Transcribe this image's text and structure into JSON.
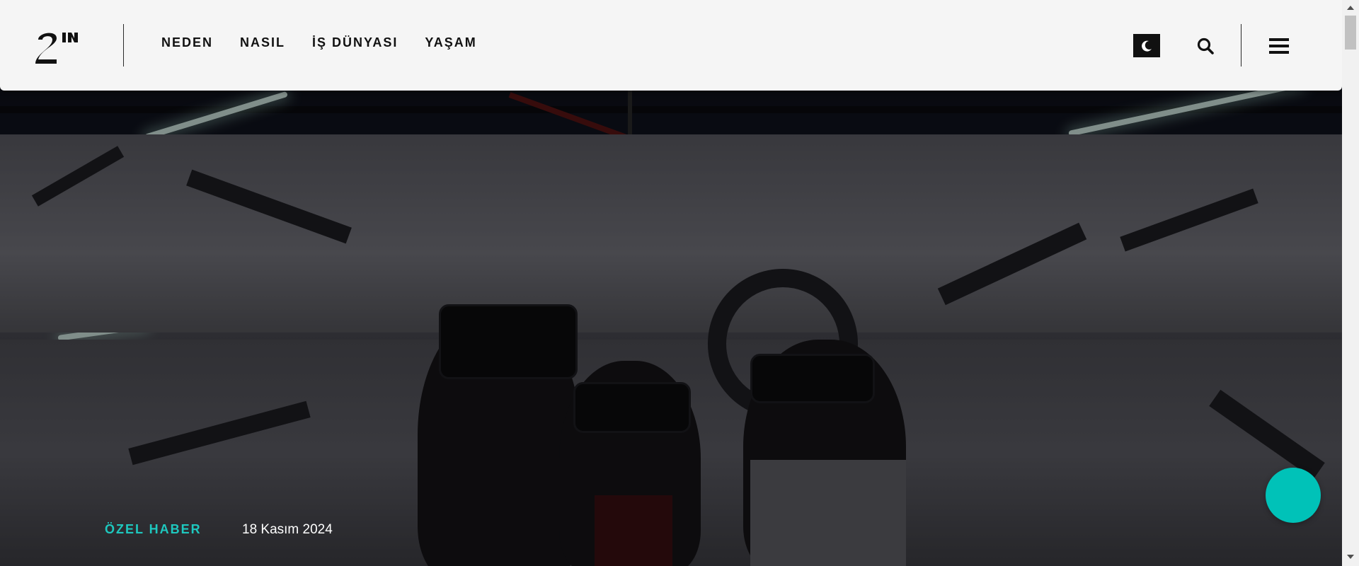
{
  "header": {
    "logo_alt": "2N logo",
    "nav": [
      {
        "label": "NEDEN"
      },
      {
        "label": "NASIL"
      },
      {
        "label": "İŞ DÜNYASI"
      },
      {
        "label": "YAŞAM"
      }
    ],
    "icons": {
      "theme": "moon-icon",
      "search": "search-icon",
      "menu": "hamburger-menu-icon"
    }
  },
  "hero": {
    "image": "vr-headset-exhibition-photo",
    "category": "ÖZEL HABER",
    "date": "18 Kasım 2024"
  },
  "colors": {
    "accent": "#1ec8bf",
    "fab": "#00c2b8",
    "header_bg": "#f5f5f5"
  },
  "chat": {
    "icon": "chat-fab"
  }
}
